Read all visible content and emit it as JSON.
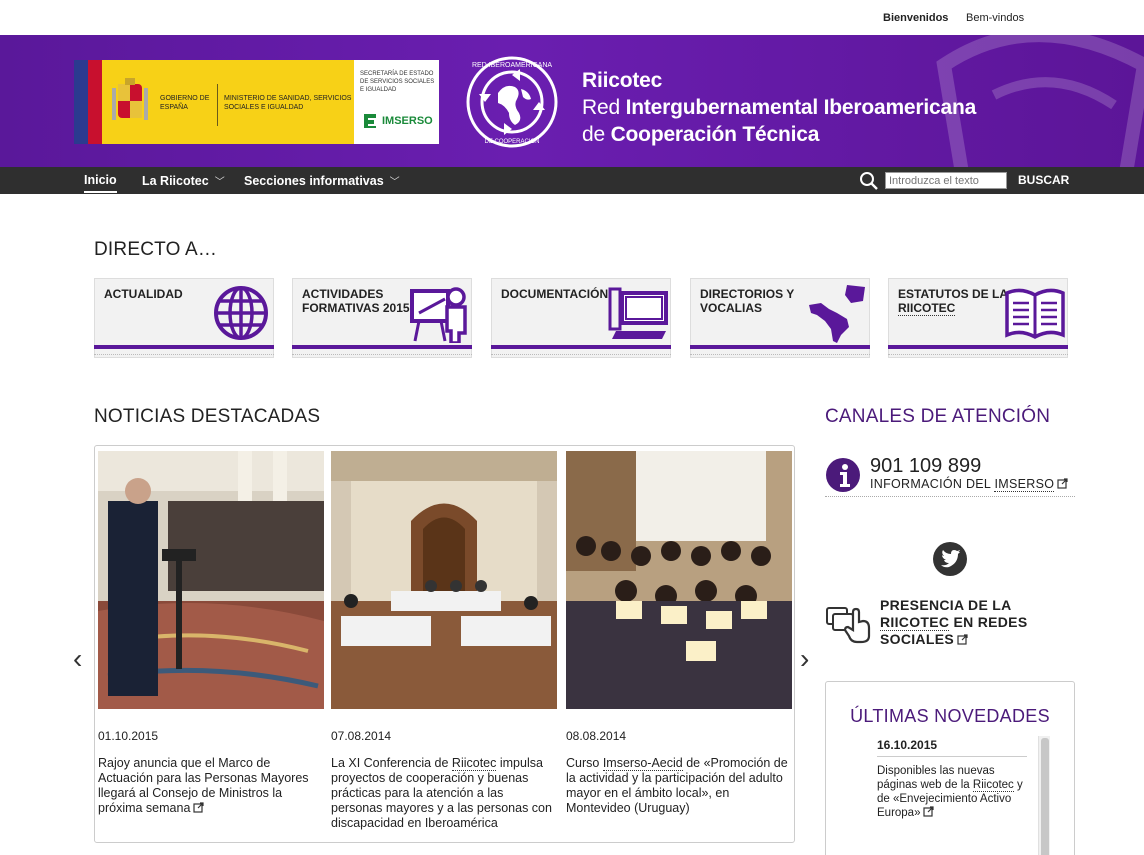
{
  "lang_bar": {
    "spanish": "Bienvenidos",
    "portuguese": "Bem-vindos"
  },
  "header": {
    "gov_logo": {
      "gobierno": "GOBIERNO DE ESPAÑA",
      "ministerio": "MINISTERIO DE SANIDAD, SERVICIOS SOCIALES E IGUALDAD",
      "secretaria": "SECRETARÍA DE ESTADO DE SERVICIOS SOCIALES E IGUALDAD",
      "imserso": "IMSERSO"
    },
    "emblem_text_top": "RED IBEROAMERICANA",
    "emblem_text_bottom": "DE COOPERACION",
    "title_line1": "Riicotec",
    "title_line2_a": "Red ",
    "title_line2_b": "Intergubernamental Iberoamericana",
    "title_line3_a": "de ",
    "title_line3_b": "Cooperación Técnica"
  },
  "nav": {
    "inicio": "Inicio",
    "riicotec": "La Riicotec",
    "secciones": "Secciones informativas",
    "chevron": "﹀",
    "search_placeholder": "Introduzca el texto",
    "search_button": "BUSCAR"
  },
  "directo": {
    "heading": "DIRECTO A…",
    "tiles": [
      {
        "label": "ACTUALIDAD",
        "icon": "globe-icon"
      },
      {
        "label": "ACTIVIDADES FORMATIVAS 2015",
        "icon": "teacher-icon"
      },
      {
        "label": "DOCUMENTACIÓN",
        "icon": "computer-icon"
      },
      {
        "label": "DIRECTORIOS Y VOCALIAS",
        "icon": "americas-map-icon"
      },
      {
        "label_a": "ESTATUTOS DE LA ",
        "label_b": "RIICOTEC",
        "icon": "book-icon"
      }
    ]
  },
  "noticias": {
    "heading": "NOTICIAS DESTACADAS",
    "items": [
      {
        "date": "01.10.2015",
        "title": "Rajoy anuncia que el Marco de Actuación para las Personas Mayores llegará al Consejo de Ministros la próxima semana"
      },
      {
        "date": "07.08.2014",
        "title_a": "La XI Conferencia de ",
        "title_link": "Riicotec",
        "title_b": " impulsa proyectos de cooperación y buenas prácticas para la atención a las personas mayores y a las personas con discapacidad en Iberoamérica"
      },
      {
        "date": "08.08.2014",
        "title_a": "Curso ",
        "title_link": "Imserso-Aecid",
        "title_b": " de «Promoción de la actividad y la participación del adulto mayor en el ámbito local», en Montevideo (Uruguay)"
      }
    ],
    "prev": "‹",
    "next": "›"
  },
  "canales": {
    "heading": "CANALES DE ATENCIÓN",
    "phone": "901 109 899",
    "phone_link_a": "INFORMACIÓN DEL ",
    "phone_link_b": "IMSERSO",
    "social_a": "PRESENCIA DE LA",
    "social_b": "RIICOTEC",
    "social_c": " EN REDES",
    "social_d": "SOCIALES"
  },
  "novedades": {
    "heading": "ÚLTIMAS NOVEDADES",
    "date": "16.10.2015",
    "text_a": "Disponibles las nuevas páginas web de la ",
    "text_link": "Riicotec",
    "text_b": " y de «Envejecimiento Activo Europa»"
  },
  "colors": {
    "brand_purple": "#5a189a",
    "nav_dark": "#2f2f2f"
  }
}
